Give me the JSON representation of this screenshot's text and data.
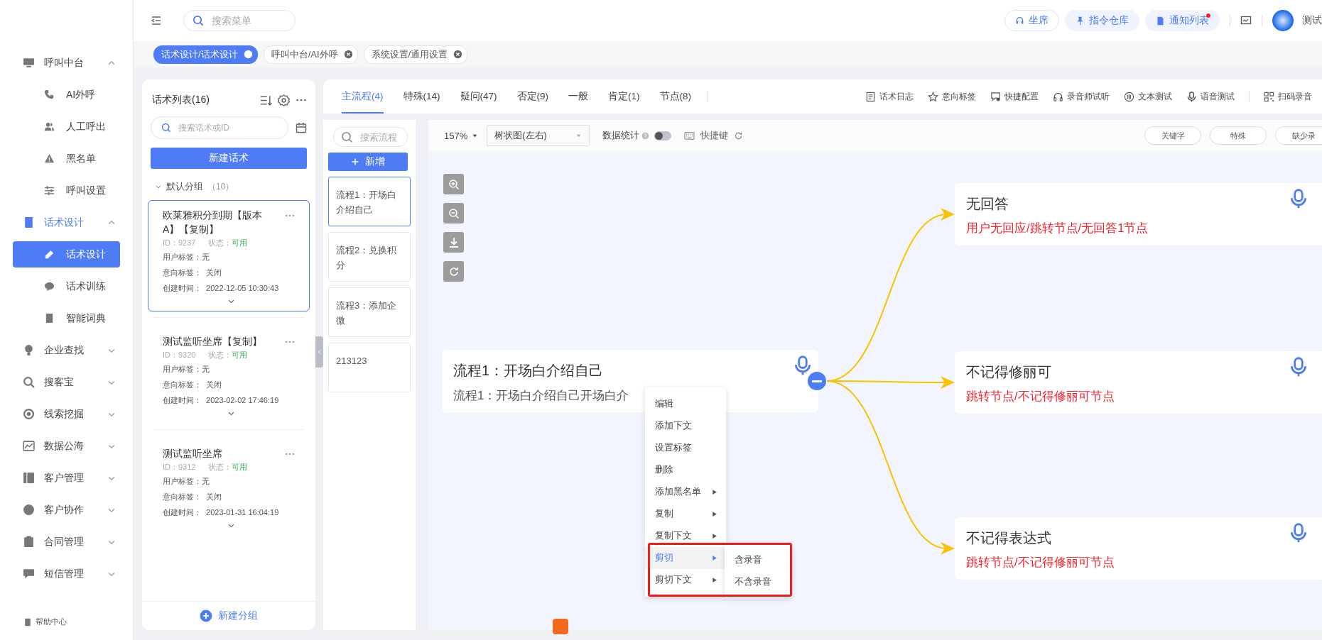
{
  "sidebar": {
    "groups": [
      {
        "label": "呼叫中台",
        "expanded": true,
        "selected": false,
        "children": [
          {
            "label": "AI外呼",
            "selected": false
          },
          {
            "label": "人工呼出",
            "selected": false
          },
          {
            "label": "黑名单",
            "selected": false
          },
          {
            "label": "呼叫设置",
            "selected": false
          }
        ]
      },
      {
        "label": "话术设计",
        "expanded": true,
        "selected": true,
        "children": [
          {
            "label": "话术设计",
            "selected": true
          },
          {
            "label": "话术训练",
            "selected": false
          },
          {
            "label": "智能词典",
            "selected": false
          }
        ]
      },
      {
        "label": "企业查找",
        "expanded": false,
        "selected": false
      },
      {
        "label": "搜客宝",
        "expanded": false,
        "selected": false
      },
      {
        "label": "线索挖掘",
        "expanded": false,
        "selected": false
      },
      {
        "label": "数据公海",
        "expanded": false,
        "selected": false
      },
      {
        "label": "客户管理",
        "expanded": false,
        "selected": false
      },
      {
        "label": "客户协作",
        "expanded": false,
        "selected": false
      },
      {
        "label": "合同管理",
        "expanded": false,
        "selected": false
      },
      {
        "label": "短信管理",
        "expanded": false,
        "selected": false
      }
    ],
    "help": "帮助中心"
  },
  "topbar": {
    "search": {
      "placeholder": "搜索菜单"
    },
    "buttons": [
      {
        "label": "坐席",
        "kind": "outline",
        "badge": false
      },
      {
        "label": "指令仓库",
        "kind": "filled",
        "badge": false
      },
      {
        "label": "通知列表",
        "kind": "filled",
        "badge": true
      }
    ],
    "user": "测试"
  },
  "open_tabs": [
    {
      "label": "话术设计/话术设计",
      "selected": true
    },
    {
      "label": "呼叫中台/AI外呼",
      "selected": false
    },
    {
      "label": "系统设置/通用设置",
      "selected": false
    }
  ],
  "script_list": {
    "title": "话术列表(16)",
    "search": {
      "placeholder": "搜索话术或ID"
    },
    "new_button": "新建话术",
    "group": {
      "label": "默认分组",
      "count": "（10）",
      "expanded": true
    },
    "scripts": [
      {
        "name": "欧莱雅积分到期【版本A】【复制】",
        "id_label": "ID：",
        "id": "9237",
        "status_label": "状态：",
        "status": "可用",
        "user_tag_label": "用户标签：",
        "user_tag": "无",
        "intent_label": "意向标签：",
        "intent": "关闭",
        "created_label": "创建时间：",
        "created": "2022-12-05 10:30:43",
        "selected": true
      },
      {
        "name": "测试监听坐席【复制】",
        "id_label": "ID：",
        "id": "9320",
        "status_label": "状态：",
        "status": "可用",
        "user_tag_label": "用户标签：",
        "user_tag": "无",
        "intent_label": "意向标签：",
        "intent": "关闭",
        "created_label": "创建时间：",
        "created": "2023-02-02 17:46:19",
        "selected": false
      },
      {
        "name": "测试监听坐席",
        "id_label": "ID：",
        "id": "9312",
        "status_label": "状态：",
        "status": "可用",
        "user_tag_label": "用户标签：",
        "user_tag": "无",
        "intent_label": "意向标签：",
        "intent": "关闭",
        "created_label": "创建时间：",
        "created": "2023-01-31 16:04:19",
        "selected": false
      }
    ],
    "new_group": "新建分组"
  },
  "main_tabs": [
    {
      "label": "主流程(4)",
      "selected": true
    },
    {
      "label": "特殊(14)",
      "selected": false
    },
    {
      "label": "疑问(47)",
      "selected": false
    },
    {
      "label": "否定(9)",
      "selected": false
    },
    {
      "label": "一般",
      "selected": false
    },
    {
      "label": "肯定(1)",
      "selected": false
    },
    {
      "label": "节点(8)",
      "selected": false
    }
  ],
  "tools": [
    "话术日志",
    "意向标签",
    "快捷配置",
    "录音师试听",
    "文本测试",
    "语音测试",
    "扫码录音"
  ],
  "flow_list": {
    "search": {
      "placeholder": "搜索流程"
    },
    "add_button": "新增",
    "items": [
      {
        "label": "流程1：开场白介绍自己",
        "selected": true
      },
      {
        "label": "流程2：兑换积分",
        "selected": false
      },
      {
        "label": "流程3：添加企微",
        "selected": false
      },
      {
        "label": "213123",
        "selected": false
      }
    ]
  },
  "canvas_toolbar": {
    "zoom": "157%",
    "layout": "树状图(左右)",
    "stats": {
      "label": "数据统计",
      "on": false
    },
    "shortcut": "快捷键",
    "buttons": [
      "关键字",
      "特殊",
      "缺少录"
    ]
  },
  "graph": {
    "root": {
      "title": "流程1：开场白介绍自己",
      "subtitle": "流程1：开场白介绍自己开场白介",
      "expanded": true
    },
    "children": [
      {
        "title": "无回答",
        "subtitle": "用户无回应/跳转节点/无回答1节点"
      },
      {
        "title": "不记得修丽可",
        "subtitle": "跳转节点/不记得修丽可节点"
      },
      {
        "title": "不记得表达式",
        "subtitle": "跳转节点/不记得修丽可节点"
      }
    ]
  },
  "context_menu": {
    "highlight_frame": true,
    "items": [
      {
        "label": "编辑",
        "submenu": false,
        "selected": false
      },
      {
        "label": "添加下文",
        "submenu": false,
        "selected": false
      },
      {
        "label": "设置标签",
        "submenu": false,
        "selected": false
      },
      {
        "label": "删除",
        "submenu": false,
        "selected": false
      },
      {
        "label": "添加黑名单",
        "submenu": true,
        "selected": false
      },
      {
        "label": "复制",
        "submenu": true,
        "selected": false
      },
      {
        "label": "复制下文",
        "submenu": true,
        "selected": false
      },
      {
        "label": "剪切",
        "submenu": true,
        "selected": true,
        "children": [
          {
            "label": "含录音"
          },
          {
            "label": "不含录音"
          }
        ]
      },
      {
        "label": "剪切下文",
        "submenu": true,
        "selected": false
      }
    ]
  }
}
